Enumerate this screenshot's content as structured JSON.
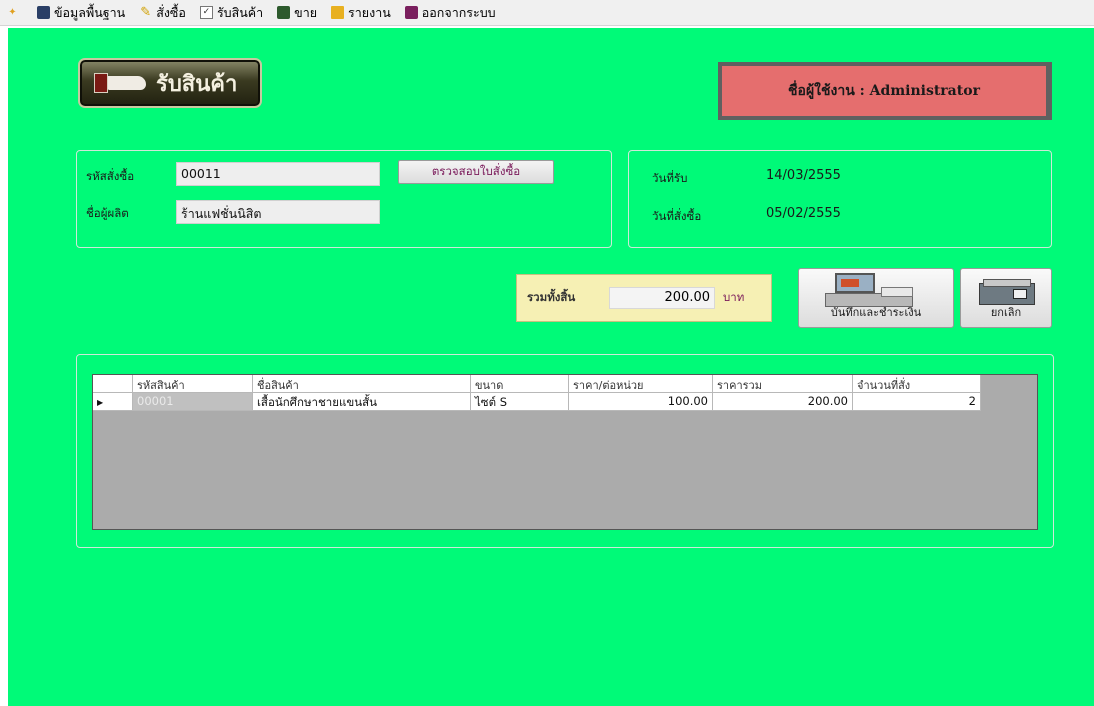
{
  "menu": [
    {
      "icon": "app-icon",
      "label": ""
    },
    {
      "icon": "database-icon",
      "label": "ข้อมูลพื้นฐาน"
    },
    {
      "icon": "order-icon",
      "label": "สั่งซื้อ"
    },
    {
      "icon": "receive-icon",
      "label": "รับสินค้า"
    },
    {
      "icon": "sell-icon",
      "label": "ขาย"
    },
    {
      "icon": "report-folder-icon",
      "label": "รายงาน"
    },
    {
      "icon": "logout-icon",
      "label": "ออกจากระบบ"
    }
  ],
  "page": {
    "title": "รับสินค้า",
    "user_label": "ชื่อผู้ใช้งาน : Administrator"
  },
  "order_info": {
    "order_id_label": "รหัสสั่งซื้อ",
    "order_id_value": "00011",
    "supplier_label": "ชื่อผู้ผลิต",
    "supplier_value": "ร้านแฟชั่นนิสิต",
    "check_button_label": "ตรวจสอบใบสั่งซื้อ"
  },
  "date_info": {
    "receive_date_label": "วันที่รับ",
    "receive_date_value": "14/03/2555",
    "order_date_label": "วันที่สั่งซื้อ",
    "order_date_value": "05/02/2555"
  },
  "total": {
    "label": "รวมทั้งสิ้น",
    "value": "200.00",
    "unit": "บาท"
  },
  "actions": {
    "save_pay_label": "บันทึกและชำระเงิน",
    "cancel_label": "ยกเลิก"
  },
  "grid": {
    "columns": [
      "รหัสสินค้า",
      "ชื่อสินค้า",
      "ขนาด",
      "ราคา/ต่อหน่วย",
      "ราคารวม",
      "จำนวนที่สั่ง"
    ],
    "rows": [
      {
        "product_id": "00001",
        "product_name": "เสื้อนักศึกษาชายแขนสั้น",
        "size": "ไซต์ S",
        "unit_price": "100.00",
        "total_price": "200.00",
        "quantity": "2"
      }
    ]
  },
  "colors": {
    "workspace": "#00fa78",
    "user_box": "#e56e6e",
    "total_panel": "#f6f0b4"
  }
}
